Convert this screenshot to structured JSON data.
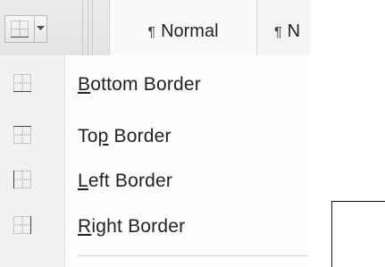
{
  "toolbar": {
    "borders_button": {
      "icon": "all-borders-icon",
      "dropdown_icon": "chevron-down-icon"
    },
    "styles": {
      "pilcrow": "¶",
      "normal_label": "Normal",
      "next_label": "N"
    }
  },
  "menu": {
    "items": [
      {
        "prefix": "",
        "accel": "B",
        "suffix": "ottom Border",
        "icon": "bottom-border-icon"
      },
      {
        "prefix": "To",
        "accel": "p",
        "suffix": " Border",
        "icon": "top-border-icon"
      },
      {
        "prefix": "",
        "accel": "L",
        "suffix": "eft Border",
        "icon": "left-border-icon"
      },
      {
        "prefix": "",
        "accel": "R",
        "suffix": "ight Border",
        "icon": "right-border-icon"
      }
    ]
  }
}
